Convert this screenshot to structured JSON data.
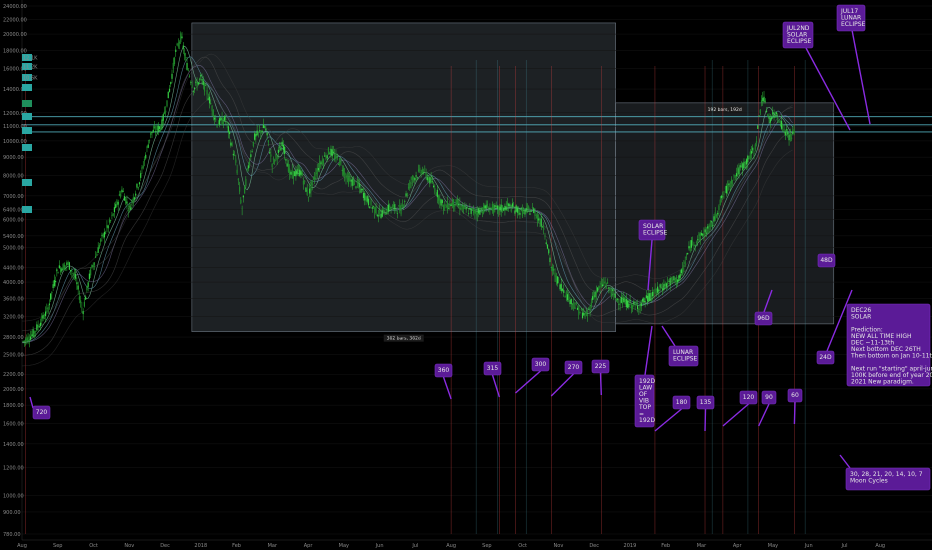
{
  "chart_data": {
    "type": "line",
    "title": "",
    "xlabel": "",
    "ylabel": "",
    "y_scale": "log",
    "ylim": [
      780,
      24000
    ],
    "y_ticks": [
      24000,
      22000,
      20000,
      18000,
      16000,
      14000,
      12000,
      11000,
      10000,
      9000,
      8000,
      7000,
      6400,
      6000,
      5400,
      5000,
      4400,
      4000,
      3600,
      3200,
      2800,
      2500,
      2200,
      2000,
      1800,
      1600,
      1400,
      1200,
      1000,
      900,
      780
    ],
    "x_ticks": [
      "Aug",
      "Sep",
      "Oct",
      "Nov",
      "Dec",
      "2018",
      "Feb",
      "Mar",
      "Apr",
      "May",
      "Jun",
      "Jul",
      "Aug",
      "Sep",
      "Oct",
      "Nov",
      "Dec",
      "2019",
      "Feb",
      "Mar",
      "Apr",
      "May",
      "Jun",
      "Jul",
      "Aug"
    ],
    "x_range_months": [
      0,
      25
    ],
    "price_series": [
      [
        0.0,
        2700
      ],
      [
        0.3,
        2850
      ],
      [
        0.7,
        3300
      ],
      [
        1.0,
        4350
      ],
      [
        1.3,
        4500
      ],
      [
        1.5,
        4100
      ],
      [
        1.7,
        3300
      ],
      [
        1.9,
        4200
      ],
      [
        2.2,
        5200
      ],
      [
        2.5,
        6000
      ],
      [
        2.8,
        7300
      ],
      [
        3.0,
        6400
      ],
      [
        3.3,
        7800
      ],
      [
        3.6,
        10500
      ],
      [
        3.9,
        11000
      ],
      [
        4.1,
        13500
      ],
      [
        4.3,
        17800
      ],
      [
        4.45,
        19700
      ],
      [
        4.6,
        16500
      ],
      [
        4.8,
        14000
      ],
      [
        5.0,
        15000
      ],
      [
        5.2,
        13500
      ],
      [
        5.45,
        11200
      ],
      [
        5.7,
        11500
      ],
      [
        6.0,
        8500
      ],
      [
        6.15,
        6400
      ],
      [
        6.3,
        8200
      ],
      [
        6.5,
        10200
      ],
      [
        6.8,
        11000
      ],
      [
        7.0,
        8600
      ],
      [
        7.3,
        9800
      ],
      [
        7.5,
        8000
      ],
      [
        7.8,
        8200
      ],
      [
        8.0,
        7000
      ],
      [
        8.3,
        8500
      ],
      [
        8.6,
        9400
      ],
      [
        8.9,
        8700
      ],
      [
        9.1,
        7800
      ],
      [
        9.4,
        7500
      ],
      [
        9.7,
        6700
      ],
      [
        10.0,
        6200
      ],
      [
        10.3,
        6500
      ],
      [
        10.6,
        6400
      ],
      [
        10.9,
        7800
      ],
      [
        11.2,
        8300
      ],
      [
        11.5,
        7500
      ],
      [
        11.8,
        6500
      ],
      [
        12.1,
        6700
      ],
      [
        12.4,
        6400
      ],
      [
        12.7,
        6300
      ],
      [
        13.0,
        6500
      ],
      [
        13.3,
        6400
      ],
      [
        13.6,
        6550
      ],
      [
        14.0,
        6300
      ],
      [
        14.3,
        6400
      ],
      [
        14.6,
        5700
      ],
      [
        14.8,
        4400
      ],
      [
        15.0,
        4000
      ],
      [
        15.3,
        3600
      ],
      [
        15.6,
        3300
      ],
      [
        15.8,
        3200
      ],
      [
        16.0,
        3700
      ],
      [
        16.3,
        4000
      ],
      [
        16.6,
        3600
      ],
      [
        16.9,
        3500
      ],
      [
        17.2,
        3400
      ],
      [
        17.5,
        3600
      ],
      [
        17.8,
        3800
      ],
      [
        18.1,
        4000
      ],
      [
        18.4,
        4100
      ],
      [
        18.7,
        5100
      ],
      [
        19.0,
        5400
      ],
      [
        19.3,
        5800
      ],
      [
        19.6,
        7000
      ],
      [
        19.9,
        7900
      ],
      [
        20.2,
        8600
      ],
      [
        20.5,
        9500
      ],
      [
        20.7,
        13500
      ],
      [
        20.9,
        11500
      ],
      [
        21.1,
        12000
      ],
      [
        21.3,
        10800
      ],
      [
        21.5,
        10200
      ],
      [
        21.6,
        10600
      ]
    ],
    "horizontal_lines": [
      11700,
      11100,
      10600
    ],
    "axis_price_tags": [
      "12.1K",
      "11.2K",
      "10.6K",
      "",
      "",
      "",
      "",
      "",
      "",
      ""
    ],
    "boxes": [
      {
        "label": "362 bars, 362d",
        "t0": 4.75,
        "t1": 16.6,
        "p_lo": 2900,
        "p_hi": 21500
      },
      {
        "label": "192 bars, 192d",
        "t0": 16.6,
        "t1": 22.7,
        "p_lo": 3050,
        "p_hi": 12800
      }
    ],
    "cycle_markers": [
      {
        "label": "720",
        "t": 0.1
      },
      {
        "label": "360",
        "t": 12.0
      },
      {
        "label": "315",
        "t": 13.35
      },
      {
        "label": "300",
        "t": 13.8
      },
      {
        "label": "270",
        "t": 14.8
      },
      {
        "label": "225",
        "t": 16.2
      },
      {
        "label": "180",
        "t": 17.7
      },
      {
        "label": "135",
        "t": 19.1
      },
      {
        "label": "120",
        "t": 19.6
      },
      {
        "label": "90",
        "t": 20.6
      },
      {
        "label": "60",
        "t": 21.6
      }
    ],
    "callouts": [
      {
        "label": "192D\nLAW\nOF\nVIB\nTOP\n=\n192D"
      },
      {
        "label": "SOLAR\nECLIPSE"
      },
      {
        "label": "LUNAR\nECLIPSE"
      },
      {
        "label": "96D"
      },
      {
        "label": "48D"
      },
      {
        "label": "24D"
      },
      {
        "label": "JUL2ND\nSOLAR\nECLIPSE"
      },
      {
        "label": "JUL17\nLUNAR\nECLIPSE"
      },
      {
        "label": "DEC26\nSOLAR\n\nPrediction:\nNEW ALL TIME HIGH\nDEC ~11-13th\nNext bottom DEC 26TH\nThen bottom on Jan 10-11th.\n\nNext run \"starting\" april-june\n100K before end of year 2020\n2021 New paradigm."
      },
      {
        "label": "30, 28, 21, 20, 14, 10, 7\nMoon Cycles"
      }
    ]
  }
}
